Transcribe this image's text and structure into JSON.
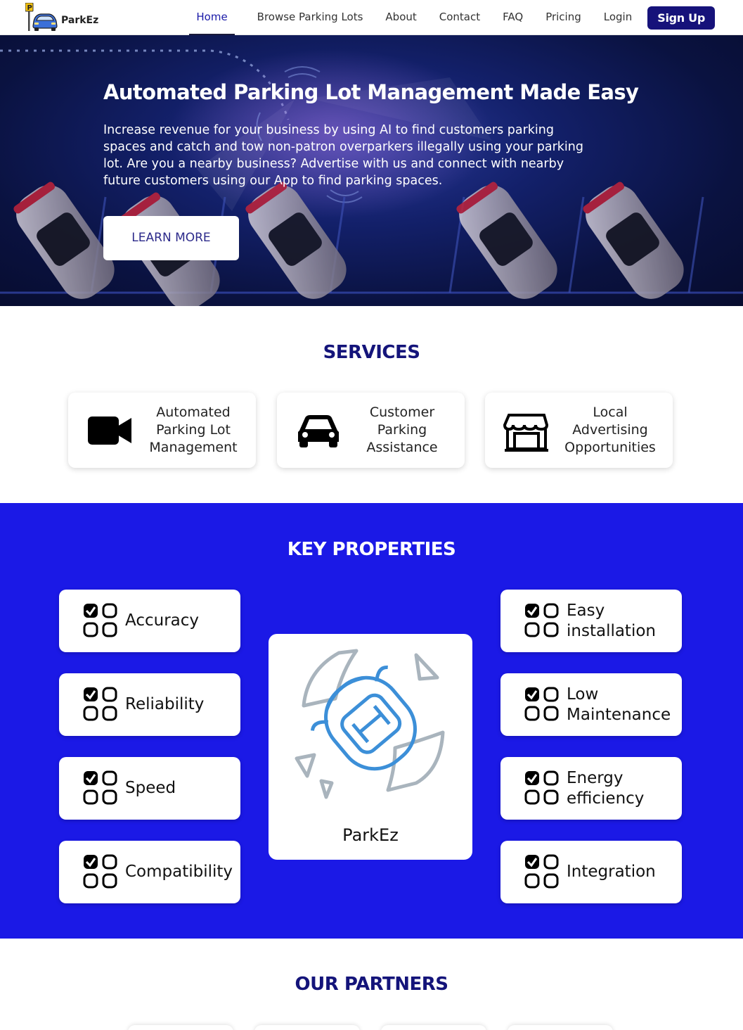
{
  "brand": {
    "name": "ParkEz"
  },
  "nav": {
    "home": "Home",
    "browse": "Browse Parking Lots",
    "about": "About",
    "contact": "Contact",
    "faq": "FAQ",
    "pricing": "Pricing",
    "login": "Login",
    "signup": "Sign Up"
  },
  "hero": {
    "title": "Automated Parking Lot Management Made Easy",
    "text": "Increase revenue for your business by using AI to find customers parking spaces and catch and tow non-patron overparkers illegally using your parking lot. Are you a nearby business? Advertise with us and connect with nearby future customers using our App to find parking spaces.",
    "cta": "LEARN MORE"
  },
  "services": {
    "title": "SERVICES",
    "items": [
      {
        "label": "Automated Parking Lot Management",
        "icon": "video-camera-icon"
      },
      {
        "label": "Customer Parking Assistance",
        "icon": "car-icon"
      },
      {
        "label": "Local Advertising Opportunities",
        "icon": "store-icon"
      }
    ]
  },
  "key_properties": {
    "title": "KEY PROPERTIES",
    "left": [
      "Accuracy",
      "Reliability",
      "Speed",
      "Compatibility"
    ],
    "right": [
      "Easy installation",
      "Low Maintenance",
      "Energy efficiency",
      "Integration"
    ],
    "center_label": "ParkEz"
  },
  "partners": {
    "title": "OUR PARTNERS"
  },
  "colors": {
    "accent": "#1b19e6",
    "navy": "#14147a",
    "signup_bg": "#16127a"
  }
}
